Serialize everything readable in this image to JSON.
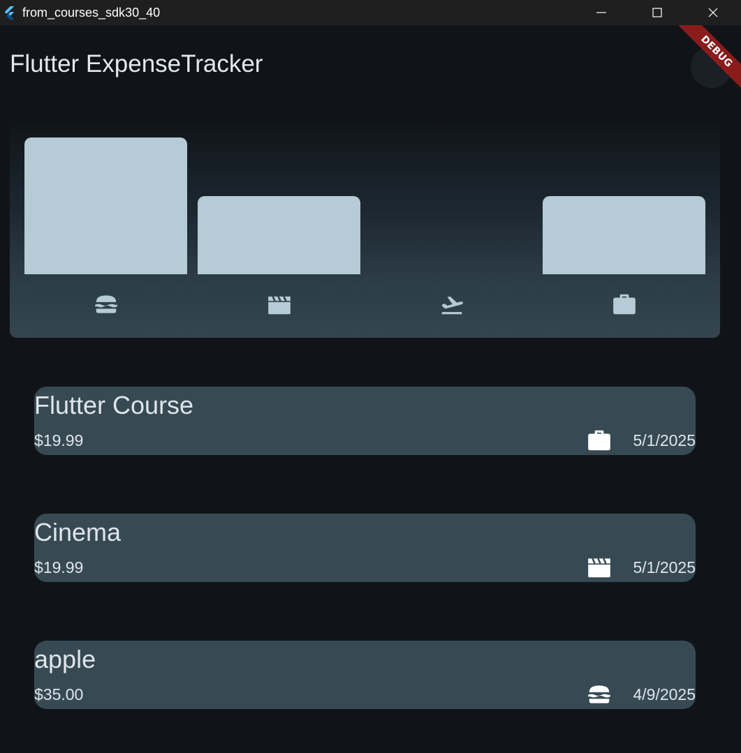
{
  "window": {
    "title": "from_courses_sdk30_40"
  },
  "appbar": {
    "title": "Flutter ExpenseTracker",
    "debug_label": "DEBUG"
  },
  "colors": {
    "background": "#101418",
    "card": "#374a54",
    "bar": "#b5cbd5",
    "text": "#dfe5ea",
    "debug_banner": "#8a1c1c"
  },
  "chart": {
    "categories": [
      {
        "icon": "burger-icon",
        "level": 0
      },
      {
        "icon": "movie-icon",
        "level": 0
      },
      {
        "icon": "flight-takeoff-icon",
        "level": 0
      },
      {
        "icon": "work-icon",
        "level": 0
      }
    ],
    "bucket_totals": [
      35.0,
      19.99,
      0,
      19.99
    ]
  },
  "expenses": [
    {
      "title": "Flutter Course",
      "amount": "$19.99",
      "icon": "work-icon",
      "date": "5/1/2025"
    },
    {
      "title": "Cinema",
      "amount": "$19.99",
      "icon": "movie-icon",
      "date": "5/1/2025"
    },
    {
      "title": "apple",
      "amount": "$35.00",
      "icon": "burger-icon",
      "date": "4/9/2025"
    }
  ]
}
